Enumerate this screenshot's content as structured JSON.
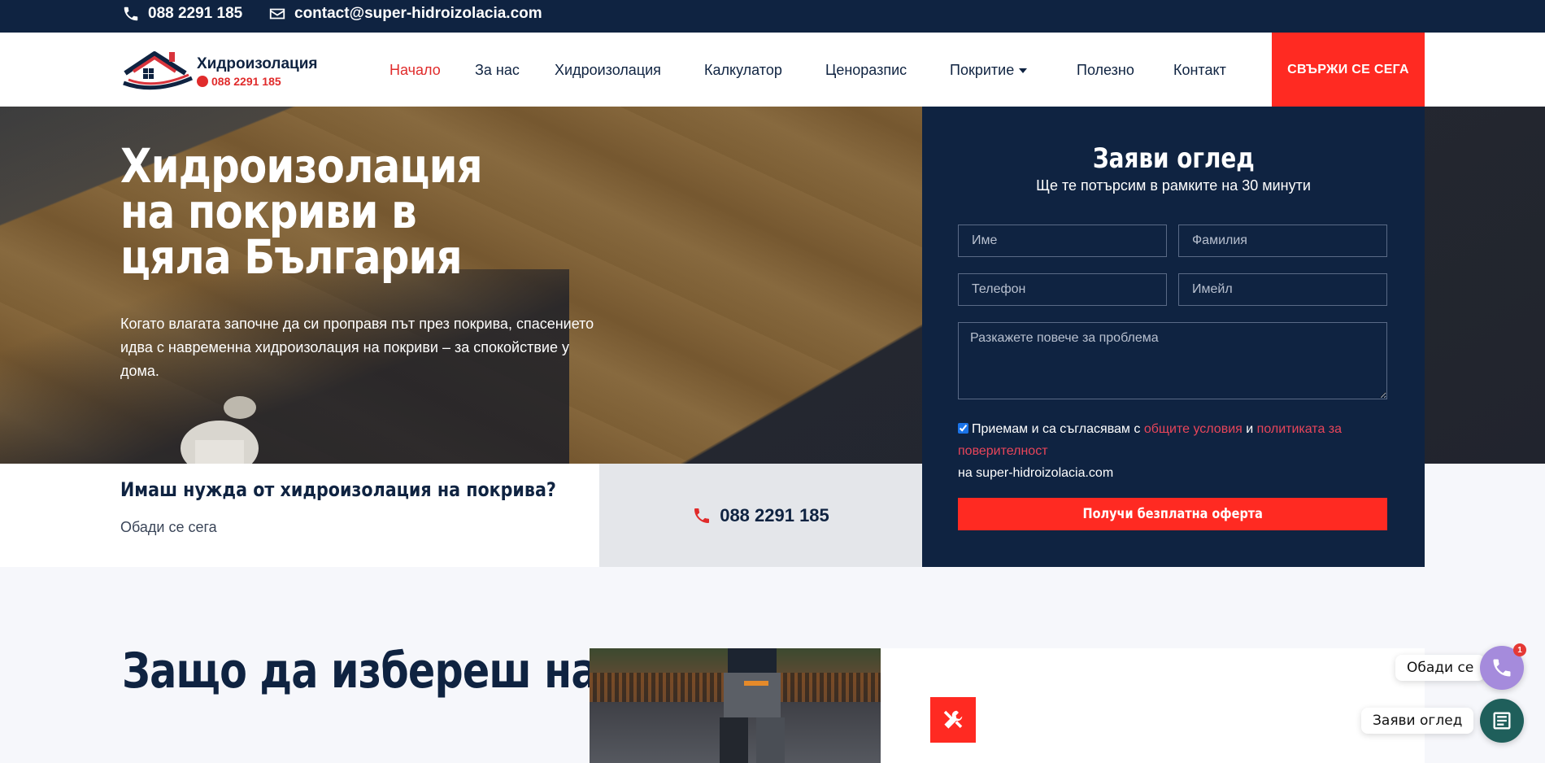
{
  "topbar": {
    "phone": "088 2291 185",
    "email": "contact@super-hidroizolacia.com"
  },
  "logo": {
    "name": "Хидроизолация",
    "phone": "088 2291 185"
  },
  "nav": {
    "items": [
      {
        "label": "Начало",
        "active": true
      },
      {
        "label": "За нас"
      },
      {
        "label": "Хидроизолация"
      },
      {
        "label": "Калкулатор"
      },
      {
        "label": "Ценоразпис"
      },
      {
        "label": "Покритие",
        "dropdown": true
      },
      {
        "label": "Полезно"
      },
      {
        "label": "Контакт"
      }
    ],
    "cta": "СВЪРЖИ СЕ СЕГА"
  },
  "hero": {
    "title": "Хидроизолация на покриви в цяла България",
    "text": "Когато влагата започне да си проправя път през покрива, спасението идва с навременна хидроизолация на покриви – за спокойствие у дома."
  },
  "call_strip": {
    "title": "Имаш нужда от хидроизолация на покрива?",
    "subtitle": "Обади се сега",
    "phone": "088 2291 185"
  },
  "form": {
    "title": "Заяви оглед",
    "subtitle": "Ще те потърсим в рамките на 30 минути",
    "first_name_placeholder": "Име",
    "last_name_placeholder": "Фамилия",
    "phone_placeholder": "Телефон",
    "email_placeholder": "Имейл",
    "message_placeholder": "Разкажете повече за проблема",
    "consent_prefix": "Приемам и са съгласявам с",
    "terms_link": "общите условия",
    "consent_and": "и",
    "privacy_link": "политиката за поверителност",
    "consent_suffix": "на super-hidroizolacia.com",
    "consent_checked": true,
    "submit": "Получи безплатна оферта"
  },
  "why": {
    "title": "Защо да избереш нас?"
  },
  "widgets": {
    "call_label": "Обади се",
    "call_badge": "1",
    "request_label": "Заяви оглед"
  },
  "colors": {
    "navy": "#0f2341",
    "accent_red": "#ff2a22",
    "call_widget": "#a58bdc",
    "request_widget": "#1f5f5b"
  }
}
